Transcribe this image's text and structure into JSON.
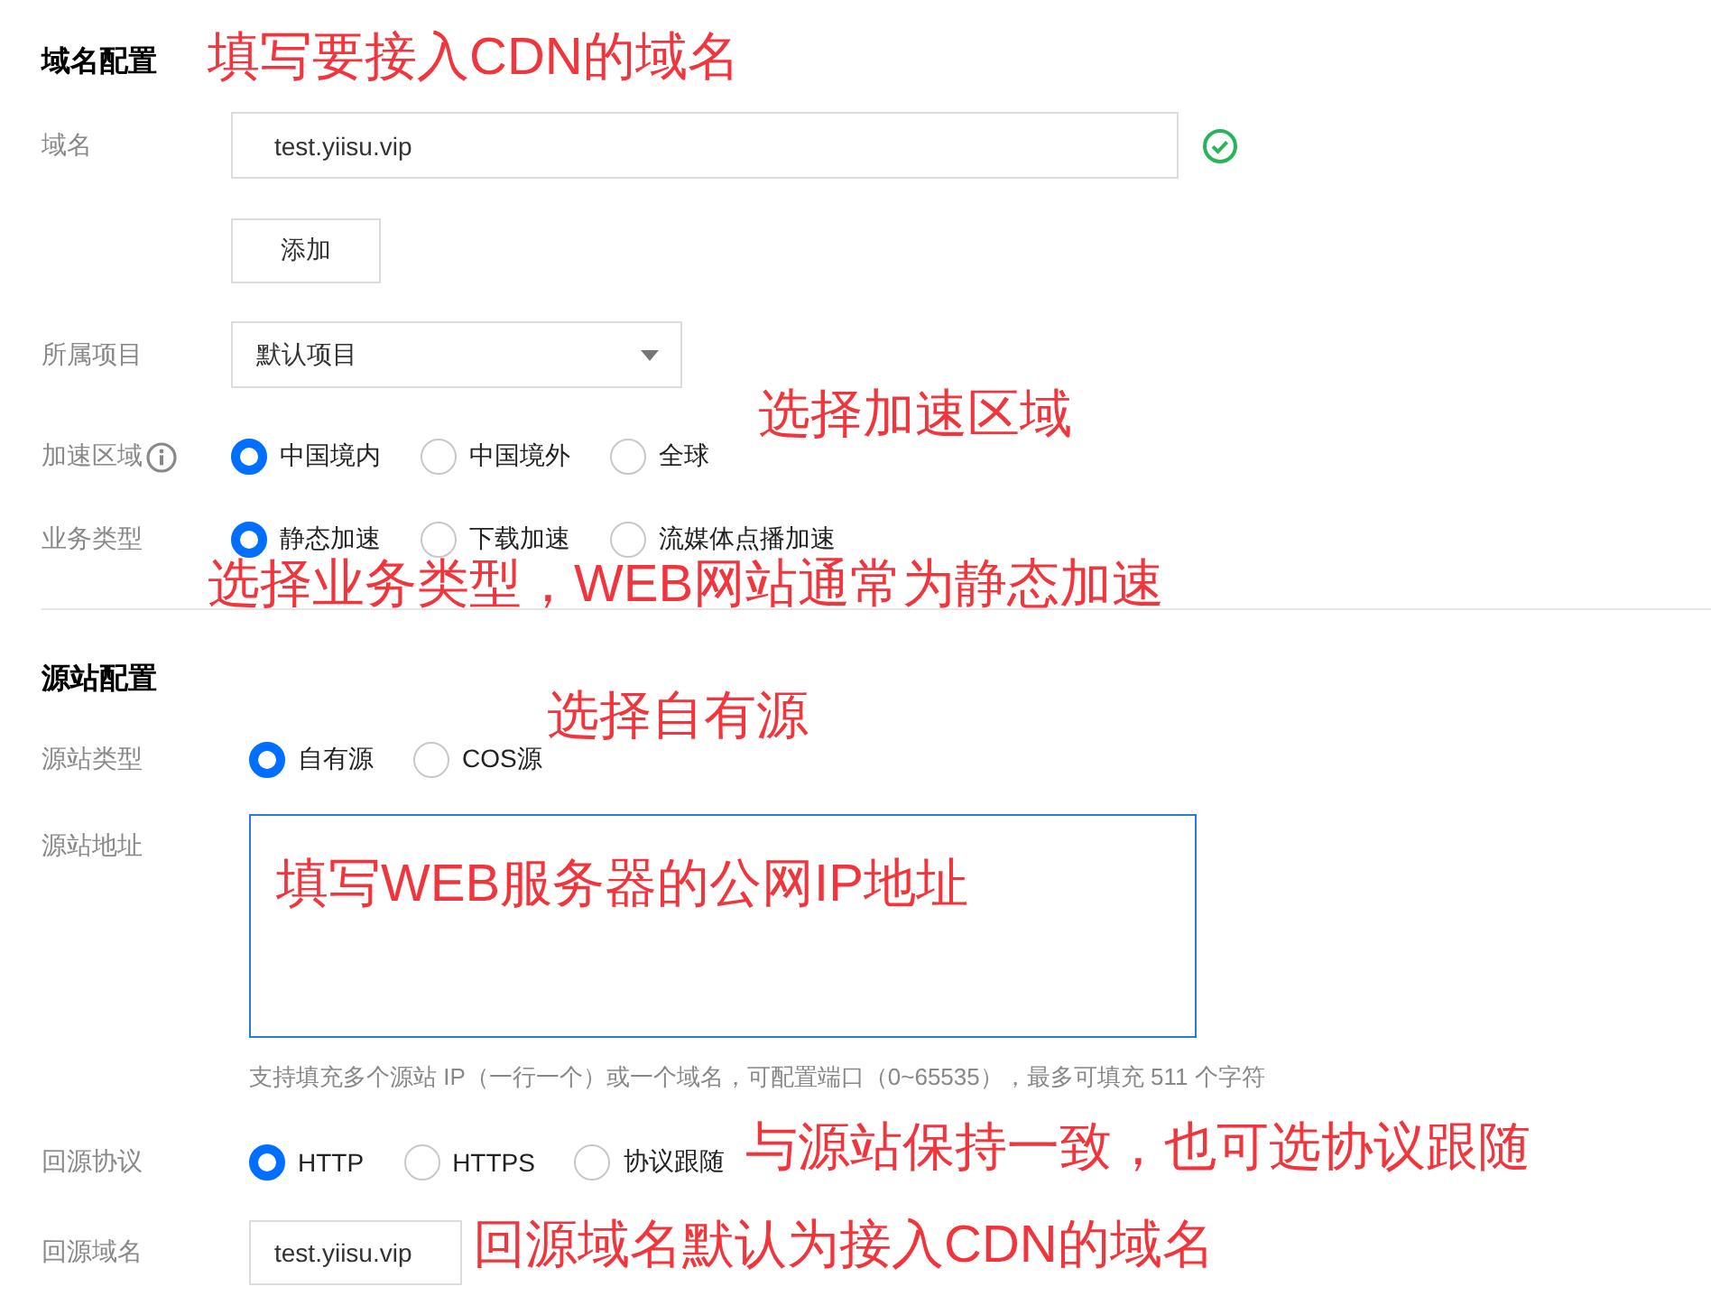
{
  "sections": [
    {
      "title": "域名配置",
      "fields": [
        {
          "kind": "input",
          "label": "域名",
          "value": "test.yiisu.vip",
          "valid": true
        },
        {
          "kind": "button",
          "text": "添加"
        },
        {
          "kind": "select",
          "label": "所属项目",
          "value": "默认项目"
        },
        {
          "kind": "radio",
          "label": "加速区域",
          "info": true,
          "options": [
            {
              "text": "中国境内",
              "selected": true
            },
            {
              "text": "中国境外",
              "selected": false
            },
            {
              "text": "全球",
              "selected": false
            }
          ]
        },
        {
          "kind": "radio",
          "label": "业务类型",
          "options": [
            {
              "text": "静态加速",
              "selected": true
            },
            {
              "text": "下载加速",
              "selected": false
            },
            {
              "text": "流媒体点播加速",
              "selected": false
            }
          ]
        }
      ]
    },
    {
      "title": "源站配置",
      "fields": [
        {
          "kind": "radio",
          "label": "源站类型",
          "options": [
            {
              "text": "自有源",
              "selected": true
            },
            {
              "text": "COS源",
              "selected": false
            }
          ]
        },
        {
          "kind": "textarea",
          "label": "源站地址",
          "focused": true
        },
        {
          "kind": "hint",
          "text": "支持填充多个源站 IP（一行一个）或一个域名，可配置端口（0~65535），最多可填充 511 个字符"
        },
        {
          "kind": "radio",
          "label": "回源协议",
          "options": [
            {
              "text": "HTTP",
              "selected": true
            },
            {
              "text": "HTTPS",
              "selected": false
            },
            {
              "text": "协议跟随",
              "selected": false
            }
          ]
        },
        {
          "kind": "input",
          "label": "回源域名",
          "value": "test.yiisu.vip"
        }
      ]
    }
  ],
  "annotations": [
    {
      "text": "填写要接入CDN的域名"
    },
    {
      "text": "选择加速区域"
    },
    {
      "text": "选择业务类型，WEB网站通常为静态加速"
    },
    {
      "text": "选择自有源"
    },
    {
      "text": "填写WEB服务器的公网IP地址"
    },
    {
      "text": "与源站保持一致，也可选协议跟随"
    },
    {
      "text": "回源域名默认为接入CDN的域名"
    }
  ]
}
